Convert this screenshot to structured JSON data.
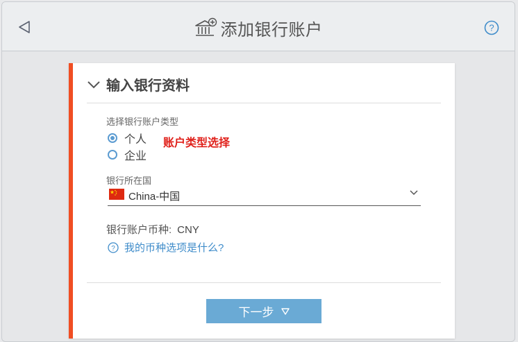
{
  "header": {
    "title": "添加银行账户",
    "back_icon": "back-triangle-icon",
    "help_icon": "help-circle-icon"
  },
  "section": {
    "title": "输入银行资料",
    "collapse_icon": "chevron-down-icon"
  },
  "account_type": {
    "label": "选择银行账户类型",
    "options": [
      {
        "label": "个人",
        "selected": true
      },
      {
        "label": "企业",
        "selected": false
      }
    ],
    "annotation": "账户类型选择"
  },
  "bank_country": {
    "label": "银行所在国",
    "value": "China-中国",
    "flag_icon": "china-flag-icon"
  },
  "currency": {
    "label": "银行账户币种:",
    "value": "CNY",
    "help_link": "我的币种选项是什么?"
  },
  "footer": {
    "next_label": "下一步"
  },
  "colors": {
    "accent": "#f04e23",
    "primary_button": "#6aaad5",
    "link": "#3f8cca",
    "annotation": "#e0201a"
  }
}
